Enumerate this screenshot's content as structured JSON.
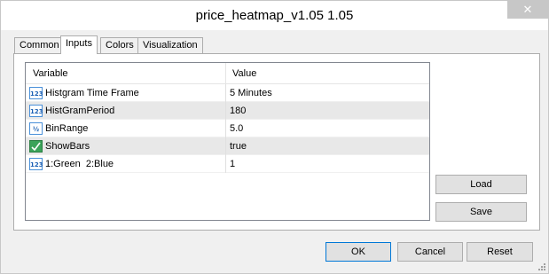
{
  "window": {
    "title": "price_heatmap_v1.05 1.05",
    "close_glyph": "✕"
  },
  "tabs": [
    {
      "label": "Common",
      "active": false
    },
    {
      "label": "Inputs",
      "active": true
    },
    {
      "label": "Colors",
      "active": false
    },
    {
      "label": "Visualization",
      "active": false
    }
  ],
  "grid": {
    "headers": {
      "variable": "Variable",
      "value": "Value"
    },
    "rows": [
      {
        "icon": "int-icon",
        "icon_text": "123",
        "variable": "Histgram Time Frame",
        "value": "5 Minutes"
      },
      {
        "icon": "int-icon",
        "icon_text": "123",
        "variable": "HistGramPeriod",
        "value": "180"
      },
      {
        "icon": "fraction-icon",
        "icon_text": "½",
        "variable": "BinRange",
        "value": "5.0"
      },
      {
        "icon": "bool-icon",
        "icon_text": "",
        "variable": "ShowBars",
        "value": "true"
      },
      {
        "icon": "int-icon",
        "icon_text": "123",
        "variable": "1:Green  2:Blue",
        "value": "1"
      }
    ]
  },
  "side_buttons": {
    "load": "Load",
    "save": "Save"
  },
  "footer_buttons": {
    "ok": "OK",
    "cancel": "Cancel",
    "reset": "Reset"
  },
  "colors": {
    "accent": "#0078d7",
    "row_shade": "#e8e8e8"
  }
}
